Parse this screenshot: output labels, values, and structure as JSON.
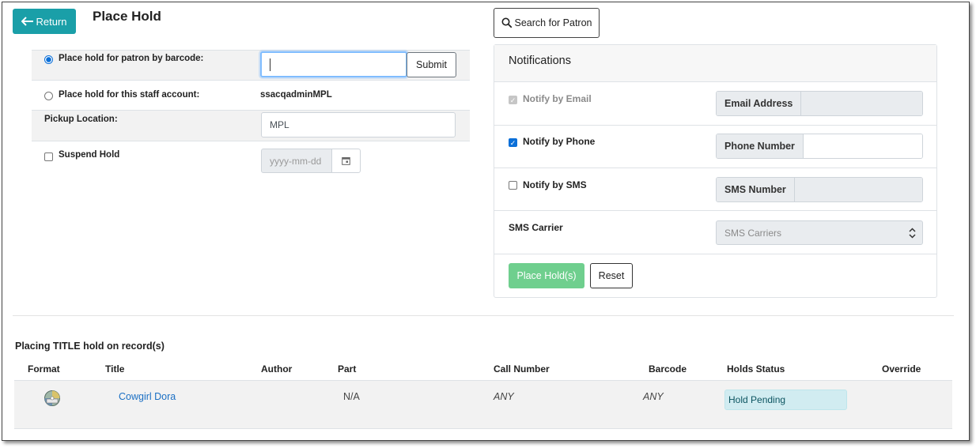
{
  "header": {
    "return_label": "Return",
    "page_title": "Place Hold",
    "search_patron_label": "Search for Patron"
  },
  "left_form": {
    "barcode_option_label": "Place hold for patron by barcode:",
    "barcode_input_value": "",
    "submit_label": "Submit",
    "staff_option_label": "Place hold for this staff account:",
    "staff_account": "ssacqadminMPL",
    "pickup_label": "Pickup Location:",
    "pickup_value": "MPL",
    "suspend_label": "Suspend Hold",
    "date_placeholder": "yyyy-mm-dd"
  },
  "notifications": {
    "title": "Notifications",
    "email_label": "Notify by Email",
    "email_checked": true,
    "email_addon": "Email Address",
    "phone_label": "Notify by Phone",
    "phone_checked": true,
    "phone_addon": "Phone Number",
    "sms_label": "Notify by SMS",
    "sms_checked": false,
    "sms_addon": "SMS Number",
    "carrier_label": "SMS Carrier",
    "carrier_value": "SMS Carriers",
    "place_label": "Place Hold(s)",
    "reset_label": "Reset"
  },
  "records": {
    "heading": "Placing TITLE hold on record(s)",
    "columns": [
      "Format",
      "Title",
      "Author",
      "Part",
      "Call Number",
      "Barcode",
      "Holds Status",
      "Override"
    ],
    "rows": [
      {
        "format_icon": "disc-icon",
        "title": "Cowgirl Dora",
        "author": "",
        "part": "N/A",
        "call_number": "ANY",
        "barcode": "ANY",
        "status": "Hold Pending"
      }
    ]
  },
  "colors": {
    "return_bg": "#1a9fa8",
    "place_bg": "#6fcf8e",
    "status_bg": "#d1ecf1",
    "link": "#1a6fc4"
  }
}
